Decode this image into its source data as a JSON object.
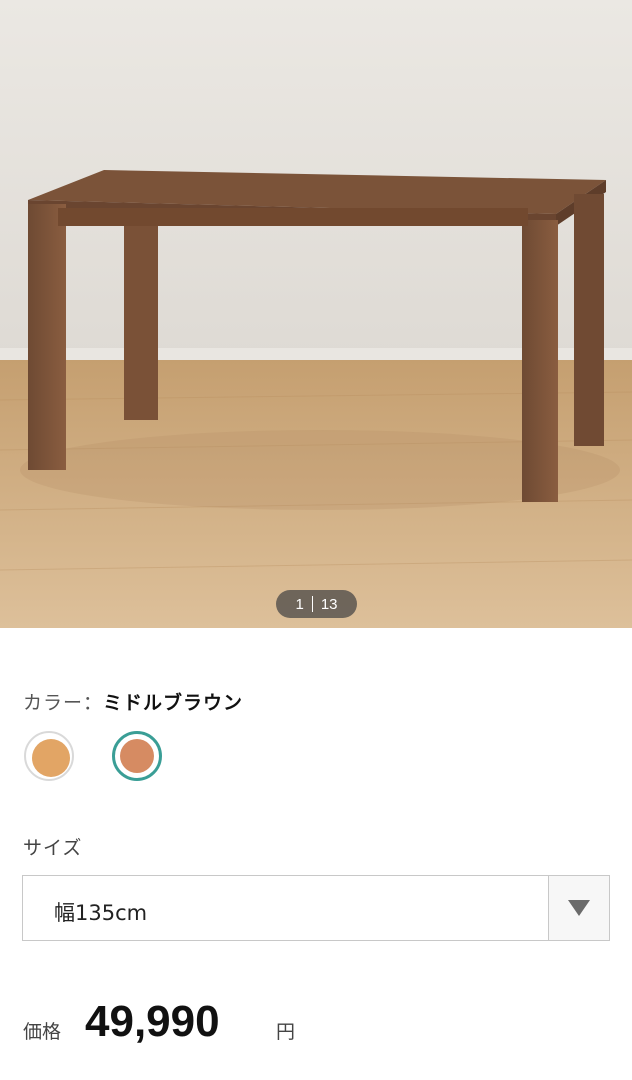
{
  "gallery": {
    "current": "1",
    "total": "13",
    "image": "furniture-product-photo"
  },
  "color": {
    "label": "カラー：",
    "selected": "ミドルブラウン",
    "swatches": [
      {
        "color": "#e2a565",
        "selected": false
      },
      {
        "color": "#d68b62",
        "selected": true
      }
    ],
    "selected_ring_color": "#3a9e96"
  },
  "size": {
    "label": "サイズ",
    "selected": "幅135cm",
    "icon": "dropdown-arrow-icon"
  },
  "price": {
    "label": "価格",
    "value": "49,990",
    "unit": "円"
  }
}
